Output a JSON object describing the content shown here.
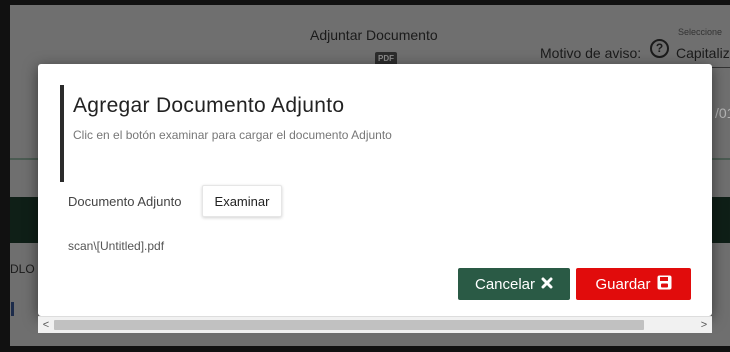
{
  "background": {
    "title": "Adjuntar Documento",
    "pdf_icon_text": "PDF",
    "motivo_label": "Motivo de aviso:",
    "help_glyph": "?",
    "select_caption": "Seleccione",
    "select_value": "Capitaliz",
    "date_fragment": "/01",
    "side_text": "DLO"
  },
  "modal": {
    "title": "Agregar Documento Adjunto",
    "subtitle": "Clic en el botón examinar para cargar el documento Adjunto",
    "doc_label": "Documento Adjunto",
    "browse_label": "Examinar",
    "file_name": "scan\\[Untitled].pdf",
    "cancel_label": "Cancelar",
    "cancel_icon": "close-icon",
    "save_label": "Guardar",
    "save_icon": "floppy-disk-icon"
  },
  "scrollbar": {
    "left_arrow": "<",
    "right_arrow": ">"
  },
  "colors": {
    "cancel_button": "#2a5a45",
    "save_button": "#e10c0c",
    "overlay": "#6f6f6f"
  }
}
